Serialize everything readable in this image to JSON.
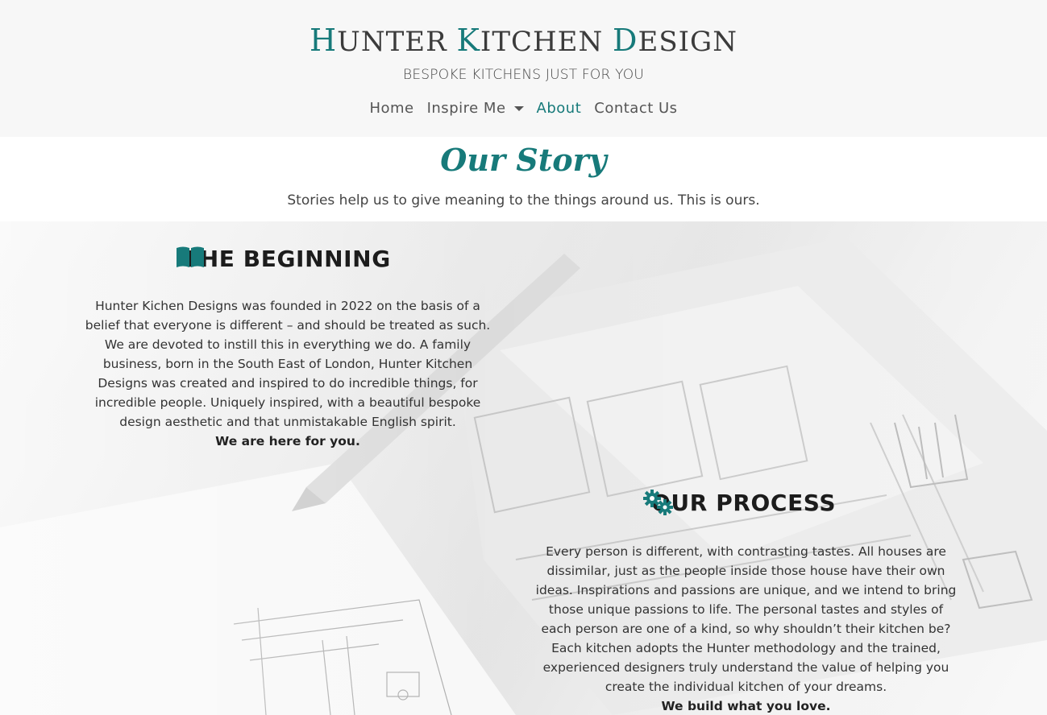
{
  "brand": {
    "word1_cap": "H",
    "word1_rest": "UNTER",
    "word2_cap": "K",
    "word2_rest": "ITCHEN",
    "word3_cap": "D",
    "word3_rest": "ESIGN"
  },
  "tagline": "BESPOKE KITCHENS JUST FOR YOU",
  "nav": {
    "home": "Home",
    "inspire": "Inspire Me",
    "about": "About",
    "contact": "Contact Us"
  },
  "story": {
    "title": "Our Story",
    "subtitle": "Stories help us to give meaning to the things around us. This is ours."
  },
  "beginning": {
    "title": "THE BEGINNING",
    "icon": "book-open-icon",
    "text": "Hunter Kichen Designs was founded in 2022 on the basis of a belief that everyone is different – and should be treated as such. We are devoted to instill this in everything we do. A family business, born in the South East of London, Hunter Kitchen Designs was created and inspired to do incredible things, for incredible people. Uniquely inspired, with a beautiful bespoke design aesthetic and that unmistakable English spirit.",
    "closing": "We are here for you."
  },
  "process": {
    "title": "OUR PROCESS",
    "icon": "gears-icon",
    "text": "Every person is different, with contrasting tastes. All houses are dissimilar, just as the people inside those house have their own ideas. Inspirations and passions are unique, and we intend to bring those unique passions to life. The personal tastes and styles of each person are one of a kind, so why shouldn’t their kitchen be? Each kitchen adopts the Hunter methodology and the trained, experienced designers truly understand the value of helping you create the individual kitchen of your dreams.",
    "closing": "We build what you love."
  },
  "colors": {
    "accent": "#177a7a",
    "header_bg": "#f7f7f7",
    "text": "#3b3b3b"
  }
}
